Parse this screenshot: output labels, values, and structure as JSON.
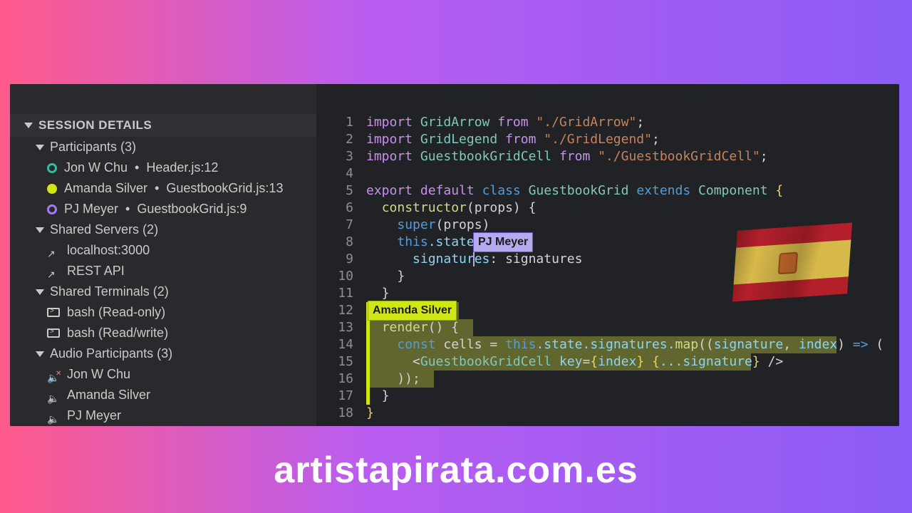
{
  "sidebar": {
    "section_title": "SESSION DETAILS",
    "participants_title": "Participants (3)",
    "participants": [
      {
        "name": "Jon W Chu",
        "location": "Header.js:12"
      },
      {
        "name": "Amanda Silver",
        "location": "GuestbookGrid.js:13"
      },
      {
        "name": "PJ Meyer",
        "location": "GuestbookGrid.js:9"
      }
    ],
    "servers_title": "Shared Servers (2)",
    "servers": [
      {
        "label": "localhost:3000"
      },
      {
        "label": "REST API"
      }
    ],
    "terminals_title": "Shared Terminals (2)",
    "terminals": [
      {
        "label": "bash (Read-only)"
      },
      {
        "label": "bash (Read/write)"
      }
    ],
    "audio_title": "Audio Participants (3)",
    "audio": [
      {
        "label": "Jon W Chu"
      },
      {
        "label": "Amanda Silver"
      },
      {
        "label": "PJ Meyer"
      }
    ]
  },
  "cursors": {
    "pj_label": "PJ Meyer",
    "amanda_label": "Amanda Silver"
  },
  "code": {
    "l1a": "import ",
    "l1b": "GridArrow ",
    "l1c": "from ",
    "l1d": "\"./GridArrow\"",
    "l1e": ";",
    "l2a": "import ",
    "l2b": "GridLegend ",
    "l2c": "from ",
    "l2d": "\"./GridLegend\"",
    "l2e": ";",
    "l3a": "import ",
    "l3b": "GuestbookGridCell ",
    "l3c": "from ",
    "l3d": "\"./GuestbookGridCell\"",
    "l3e": ";",
    "l5a": "export default ",
    "l5b": "class ",
    "l5c": "GuestbookGrid ",
    "l5d": "extends ",
    "l5e": "Component ",
    "l5f": "{",
    "l6a": "  ",
    "l6b": "constructor",
    "l6c": "(props) {",
    "l7a": "    ",
    "l7b": "super",
    "l7c": "(props)",
    "l8a": "    ",
    "l8b": "this",
    "l8c": ".state ",
    "l8d": "= ",
    "l9a": "      signatures",
    "l9b": ": ",
    "l9c": "signatures",
    "l10": "    }",
    "l11": "  }",
    "l13a": "  ",
    "l13b": "render",
    "l13c": "() {",
    "l14a": "    ",
    "l14b": "const ",
    "l14c": "cells ",
    "l14d": "= ",
    "l14e": "this",
    "l14f": ".state.signatures.",
    "l14g": "map",
    "l14h": "((",
    "l14i": "signature",
    "l14j": ", ",
    "l14k": "index",
    "l14l": ") ",
    "l14m": "=>",
    "l14n": " (",
    "l15a": "      <",
    "l15b": "GuestbookGridCell ",
    "l15c": "key",
    "l15d": "=",
    "l15e": "{",
    "l15f": "index",
    "l15g": "} {",
    "l15h": "...signature",
    "l15i": "} ",
    "l15j": "/>",
    "l16": "    ));",
    "l17": "  }",
    "l18": "}"
  },
  "gutter": [
    "1",
    "2",
    "3",
    "4",
    "5",
    "6",
    "7",
    "8",
    "9",
    "10",
    "11",
    "12",
    "13",
    "14",
    "15",
    "16",
    "17",
    "18"
  ],
  "footer": "artistapirata.com.es"
}
